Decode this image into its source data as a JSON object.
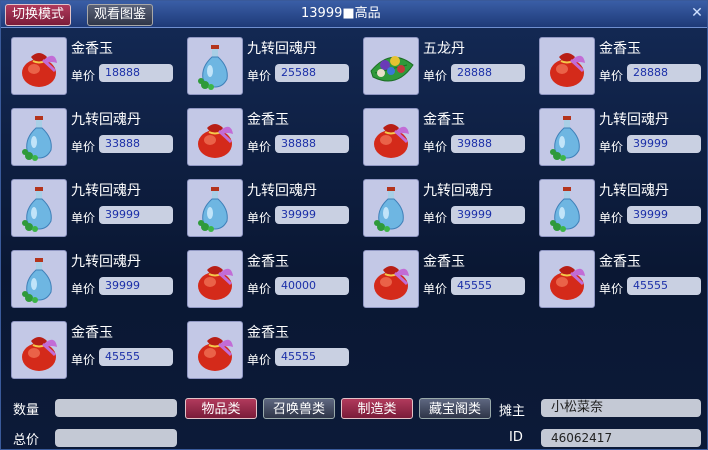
{
  "top": {
    "tab_switch": "切换模式",
    "tab_catalog": "观看图鉴",
    "title": "13999■高品",
    "close": "✕"
  },
  "price_label": "单价",
  "items": [
    {
      "name": "金香玉",
      "price": "18888",
      "icon": "red-bag-icon"
    },
    {
      "name": "九转回魂丹",
      "price": "25588",
      "icon": "blue-bottle-icon"
    },
    {
      "name": "五龙丹",
      "price": "28888",
      "icon": "five-dragon-pill-icon"
    },
    {
      "name": "金香玉",
      "price": "28888",
      "icon": "red-bag-icon"
    },
    {
      "name": "九转回魂丹",
      "price": "33888",
      "icon": "blue-bottle-icon"
    },
    {
      "name": "金香玉",
      "price": "38888",
      "icon": "red-bag-icon"
    },
    {
      "name": "金香玉",
      "price": "39888",
      "icon": "red-bag-icon"
    },
    {
      "name": "九转回魂丹",
      "price": "39999",
      "icon": "blue-bottle-icon"
    },
    {
      "name": "九转回魂丹",
      "price": "39999",
      "icon": "blue-bottle-icon"
    },
    {
      "name": "九转回魂丹",
      "price": "39999",
      "icon": "blue-bottle-icon"
    },
    {
      "name": "九转回魂丹",
      "price": "39999",
      "icon": "blue-bottle-icon"
    },
    {
      "name": "九转回魂丹",
      "price": "39999",
      "icon": "blue-bottle-icon"
    },
    {
      "name": "九转回魂丹",
      "price": "39999",
      "icon": "blue-bottle-icon"
    },
    {
      "name": "金香玉",
      "price": "40000",
      "icon": "red-bag-icon"
    },
    {
      "name": "金香玉",
      "price": "45555",
      "icon": "red-bag-icon"
    },
    {
      "name": "金香玉",
      "price": "45555",
      "icon": "red-bag-icon"
    },
    {
      "name": "金香玉",
      "price": "45555",
      "icon": "red-bag-icon"
    },
    {
      "name": "金香玉",
      "price": "45555",
      "icon": "red-bag-icon"
    }
  ],
  "bottom": {
    "quantity_label": "数量",
    "quantity_value": "",
    "total_label": "总价",
    "total_value": "",
    "categories": [
      "物品类",
      "召唤兽类",
      "制造类",
      "藏宝阁类"
    ],
    "active_categories": [
      0,
      2
    ],
    "owner_label": "摊主",
    "owner_value": "小松菜奈",
    "id_label": "ID",
    "id_value": "46062417"
  },
  "colors": {
    "accent": "#8b2244",
    "price_text": "#1b2fa8"
  }
}
